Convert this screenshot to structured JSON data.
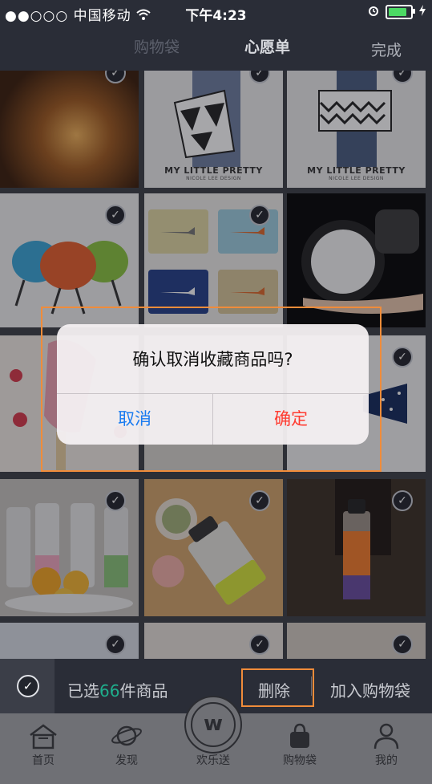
{
  "status_bar": {
    "signal": "●●○○○",
    "carrier": "中国移动",
    "time": "下午4:23"
  },
  "nav": {
    "tabs": [
      "购物袋",
      "心愿单"
    ],
    "done_label": "完成"
  },
  "grid": {
    "captions": [
      {
        "title": "MY LITTLE PRETTY",
        "sub": "NICOLE LEE DESIGN"
      },
      {
        "title": "MY LITTLE PRETTY",
        "sub": "NICOLE LEE DESIGN"
      }
    ]
  },
  "dialog": {
    "message": "确认取消收藏商品吗?",
    "cancel_label": "取消",
    "confirm_label": "确定"
  },
  "action_bar": {
    "selected_prefix": "已选",
    "selected_count": "66",
    "selected_suffix": "件商品",
    "delete_label": "删除",
    "add_to_bag_label": "加入购物袋"
  },
  "tabbar": {
    "items": [
      {
        "label": "首页",
        "icon": "home-icon"
      },
      {
        "label": "发现",
        "icon": "planet-icon"
      },
      {
        "label": "欢乐送",
        "icon": "w-logo-icon"
      },
      {
        "label": "购物袋",
        "icon": "bag-icon"
      },
      {
        "label": "我的",
        "icon": "person-icon"
      }
    ],
    "center_glyph": "w"
  },
  "colors": {
    "accent_count": "#1fae8c",
    "dialog_cancel": "#1a7bf0",
    "dialog_confirm": "#ff3b30",
    "highlight_box": "#f08c3a"
  }
}
